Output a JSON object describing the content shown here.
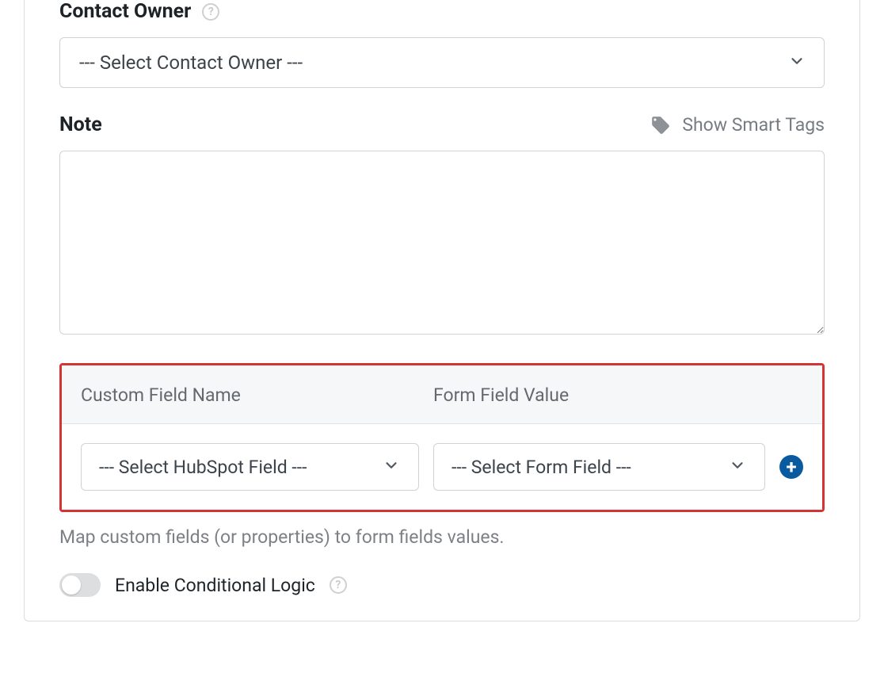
{
  "contactOwner": {
    "label": "Contact Owner",
    "selectedValue": "--- Select Contact Owner ---"
  },
  "note": {
    "label": "Note",
    "smartTagsLabel": "Show Smart Tags",
    "value": ""
  },
  "customFields": {
    "header": {
      "name": "Custom Field Name",
      "value": "Form Field Value"
    },
    "rows": [
      {
        "hubspotField": "--- Select HubSpot Field ---",
        "formField": "--- Select Form Field ---"
      }
    ],
    "helperText": "Map custom fields (or properties) to form fields values."
  },
  "conditionalLogic": {
    "label": "Enable Conditional Logic",
    "enabled": false
  }
}
